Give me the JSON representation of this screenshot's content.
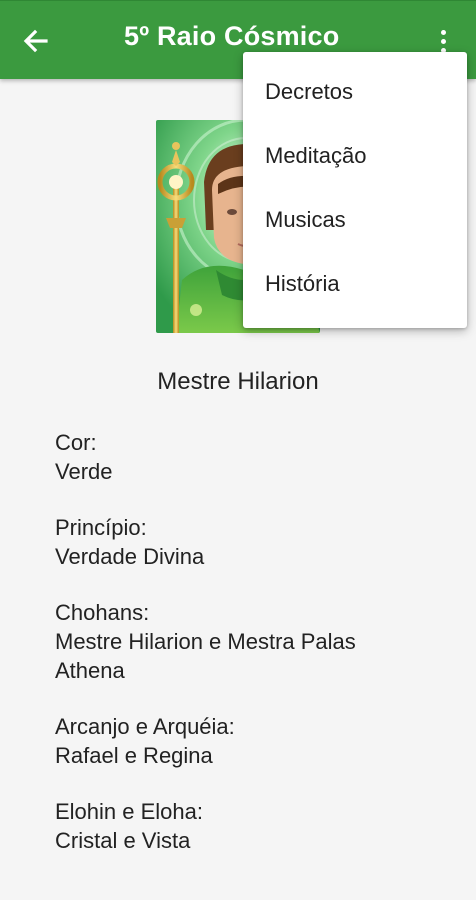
{
  "appbar": {
    "title": "5º Raio Cósmico",
    "color": "#3b9a3f"
  },
  "content": {
    "master_name": "Mestre Hilarion",
    "fields": [
      {
        "label": "Cor:",
        "value": "Verde"
      },
      {
        "label": "Princípio:",
        "value": "Verdade Divina"
      },
      {
        "label": "Chohans:",
        "value": "Mestre Hilarion e Mestra Palas Athena"
      },
      {
        "label": "Arcanjo e Arquéia:",
        "value": "Rafael e Regina"
      },
      {
        "label": "Elohin e Eloha:",
        "value": "Cristal e Vista"
      }
    ]
  },
  "menu": {
    "items": [
      "Decretos",
      "Meditação",
      "Musicas",
      "História"
    ]
  },
  "icons": {
    "back": "arrow-back-icon",
    "overflow": "more-vert-icon"
  }
}
